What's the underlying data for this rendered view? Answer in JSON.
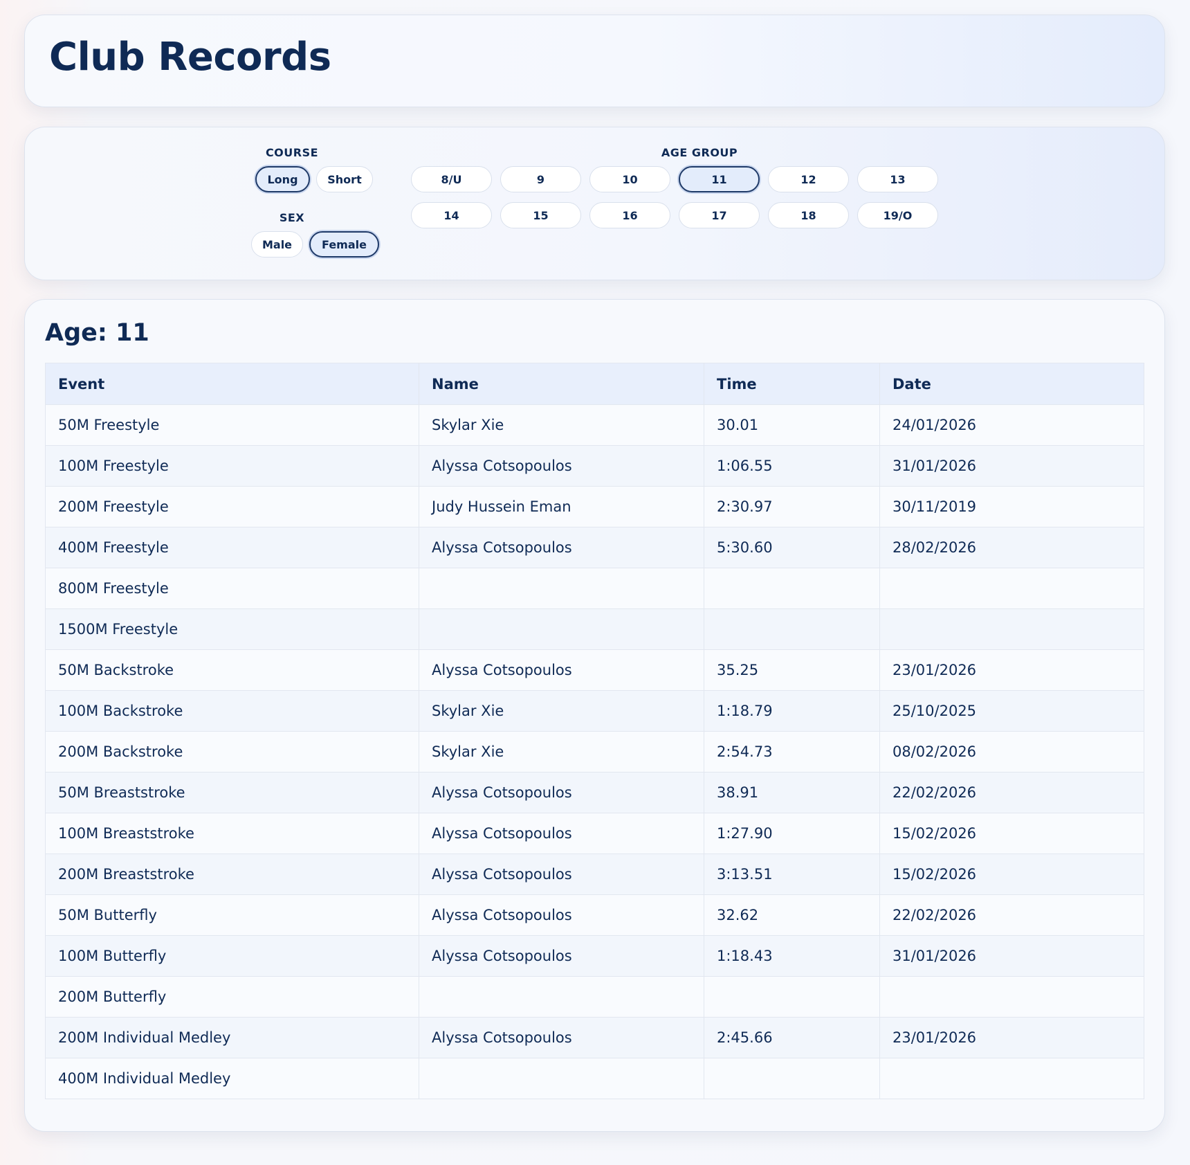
{
  "header": {
    "title": "Club Records"
  },
  "filters": {
    "course_label": "COURSE",
    "course_options": [
      "Long",
      "Short"
    ],
    "course_selected": "Long",
    "sex_label": "SEX",
    "sex_options": [
      "Male",
      "Female"
    ],
    "sex_selected": "Female",
    "age_label": "AGE GROUP",
    "age_options": [
      "8/U",
      "9",
      "10",
      "11",
      "12",
      "13",
      "14",
      "15",
      "16",
      "17",
      "18",
      "19/O"
    ],
    "age_selected": "11"
  },
  "section": {
    "title": "Age: 11"
  },
  "table": {
    "columns": [
      "Event",
      "Name",
      "Time",
      "Date"
    ],
    "rows": [
      [
        "50M Freestyle",
        "Skylar Xie",
        "30.01",
        "24/01/2026"
      ],
      [
        "100M Freestyle",
        "Alyssa Cotsopoulos",
        "1:06.55",
        "31/01/2026"
      ],
      [
        "200M Freestyle",
        "Judy Hussein Eman",
        "2:30.97",
        "30/11/2019"
      ],
      [
        "400M Freestyle",
        "Alyssa Cotsopoulos",
        "5:30.60",
        "28/02/2026"
      ],
      [
        "800M Freestyle",
        "",
        "",
        ""
      ],
      [
        "1500M Freestyle",
        "",
        "",
        ""
      ],
      [
        "50M Backstroke",
        "Alyssa Cotsopoulos",
        "35.25",
        "23/01/2026"
      ],
      [
        "100M Backstroke",
        "Skylar Xie",
        "1:18.79",
        "25/10/2025"
      ],
      [
        "200M Backstroke",
        "Skylar Xie",
        "2:54.73",
        "08/02/2026"
      ],
      [
        "50M Breaststroke",
        "Alyssa Cotsopoulos",
        "38.91",
        "22/02/2026"
      ],
      [
        "100M Breaststroke",
        "Alyssa Cotsopoulos",
        "1:27.90",
        "15/02/2026"
      ],
      [
        "200M Breaststroke",
        "Alyssa Cotsopoulos",
        "3:13.51",
        "15/02/2026"
      ],
      [
        "50M Butterfly",
        "Alyssa Cotsopoulos",
        "32.62",
        "22/02/2026"
      ],
      [
        "100M Butterfly",
        "Alyssa Cotsopoulos",
        "1:18.43",
        "31/01/2026"
      ],
      [
        "200M Butterfly",
        "",
        "",
        ""
      ],
      [
        "200M Individual Medley",
        "Alyssa Cotsopoulos",
        "2:45.66",
        "23/01/2026"
      ],
      [
        "400M Individual Medley",
        "",
        "",
        ""
      ]
    ]
  },
  "colors": {
    "text": "#0f2a55",
    "header_row_bg": "#e8effc",
    "active_pill_bg": "#e3ecfb",
    "active_pill_border": "#1f3a68"
  }
}
